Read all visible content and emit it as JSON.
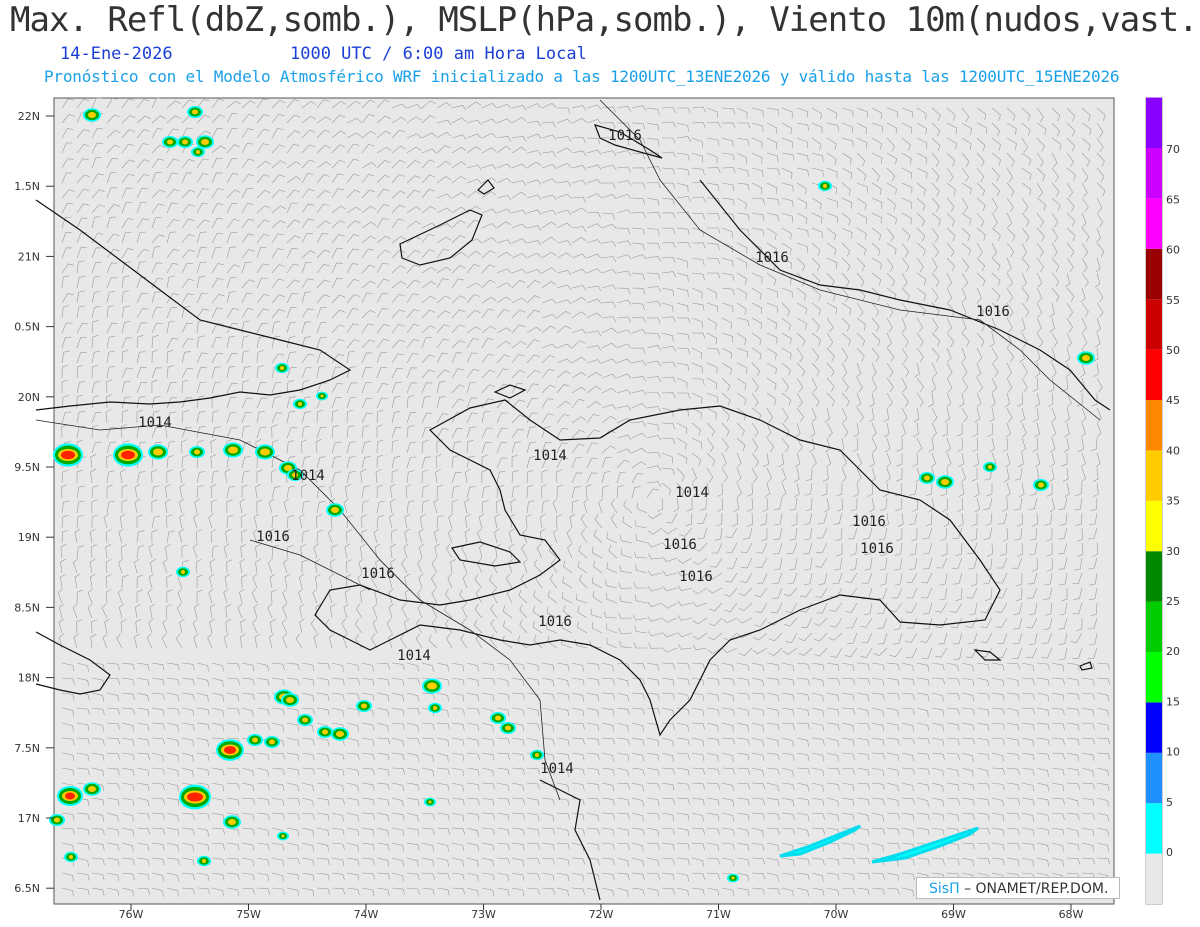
{
  "header": {
    "title": "Max. Refl(dbZ,somb.), MSLP(hPa,somb.), Viento 10m(nudos,vast.)",
    "date": "14-Ene-2026",
    "time": "1000 UTC / 6:00 am Hora Local",
    "description": "Pronóstico con el Modelo Atmosférico WRF inicializado a las 1200UTC_13ENE2026 y válido hasta las  1200UTC_15ENE2026"
  },
  "map": {
    "lat_labels": [
      "22N",
      "1.5N",
      "21N",
      "0.5N",
      "20N",
      "9.5N",
      "19N",
      "8.5N",
      "18N",
      "7.5N",
      "17N",
      "6.5N"
    ],
    "lon_labels": [
      "76W",
      "75W",
      "74W",
      "73W",
      "72W",
      "71W",
      "70W",
      "69W",
      "68W"
    ],
    "isobar_labels": [
      "1016",
      "1016",
      "1016",
      "1014",
      "1014",
      "1014",
      "1014",
      "1016",
      "1016",
      "1016",
      "1016",
      "1016",
      "1016",
      "1016",
      "1014",
      "1014"
    ],
    "ocean_color": "#e8e8e8",
    "coast_color": "#111111"
  },
  "colorbar": {
    "labels": [
      "0",
      "5",
      "10",
      "15",
      "20",
      "25",
      "30",
      "35",
      "40",
      "45",
      "50",
      "55",
      "60",
      "65",
      "70"
    ],
    "colors": [
      "#e8e8e8",
      "#00ffff",
      "#1e90ff",
      "#0000ff",
      "#00ff00",
      "#00cc00",
      "#008800",
      "#ffff00",
      "#ffcc00",
      "#ff8800",
      "#ff0000",
      "#cc0000",
      "#990000",
      "#ff00ff",
      "#cc00ff",
      "#8800ff",
      "#ffffff"
    ]
  },
  "credit": {
    "sis": "SisΠ",
    "text": "– ONAMET/REP.DOM."
  }
}
